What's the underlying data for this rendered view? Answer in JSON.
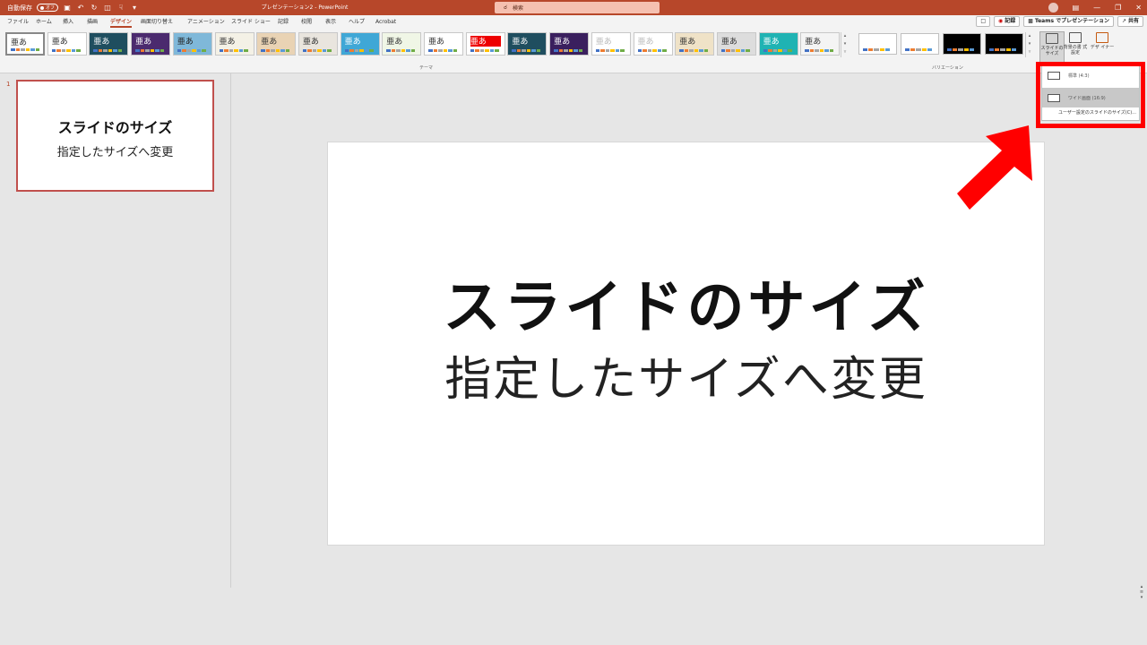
{
  "titlebar": {
    "autosave_label": "自動保存",
    "autosave_state": "オフ",
    "document_title": "プレゼンテーション2 - PowerPoint",
    "search_placeholder": "検索"
  },
  "tabs": [
    "ファイル",
    "ホーム",
    "挿入",
    "描画",
    "デザイン",
    "画面切り替え",
    "アニメーション",
    "スライド ショー",
    "記録",
    "校閲",
    "表示",
    "ヘルプ",
    "Acrobat"
  ],
  "active_tab": "デザイン",
  "tab_actions": {
    "record": "記録",
    "teams": "Teams でプレゼンテーション",
    "share": "共有"
  },
  "ribbon": {
    "theme_sample_text": "亜あ",
    "themes_group_label": "テーマ",
    "variants_group_label": "バリエーション",
    "slide_size_button": "スライドの サイズ",
    "format_background_button": "背景の書 式設定",
    "designer_button": "デザ イナー"
  },
  "slide_size_menu": {
    "standard": "標準 (4:3)",
    "widescreen": "ワイド画面 (16:9)",
    "custom": "ユーザー設定のスライドのサイズ(C)..."
  },
  "thumbnail": {
    "number": "1",
    "title": "スライドのサイズ",
    "subtitle": "指定したサイズへ変更"
  },
  "slide": {
    "title": "スライドのサイズ",
    "subtitle": "指定したサイズへ変更"
  },
  "colors": {
    "accent": "#b7472a",
    "highlight": "#ff0000"
  }
}
